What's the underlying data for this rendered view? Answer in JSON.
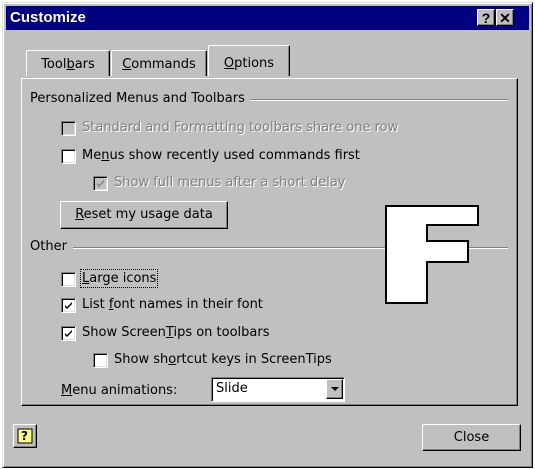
{
  "window": {
    "title": "Customize",
    "help_button": "?",
    "close_button": "✕"
  },
  "tabs": [
    {
      "pre": "Tool",
      "key": "b",
      "post": "ars"
    },
    {
      "pre": "",
      "key": "C",
      "post": "ommands"
    },
    {
      "pre": "",
      "key": "O",
      "post": "ptions"
    }
  ],
  "active_tab": "Options",
  "personalized": {
    "group_label": "Personalized Menus and Toolbars",
    "standard_row": {
      "text": "Standard and Formatting toolbars share one row",
      "checked": false,
      "enabled": false
    },
    "recent_first": {
      "pre": "Me",
      "key": "n",
      "post": "us show recently used commands first",
      "checked": false
    },
    "full_menus": {
      "text": "Show full menus after a short delay",
      "checked": true,
      "enabled": false
    },
    "reset_button": {
      "pre": "",
      "key": "R",
      "post": "eset my usage data"
    }
  },
  "other": {
    "group_label": "Other",
    "large_icons": {
      "pre": "",
      "key": "L",
      "post": "arge icons",
      "checked": false
    },
    "font_names": {
      "pre": "List ",
      "key": "f",
      "post": "ont names in their font",
      "checked": true
    },
    "screentips": {
      "pre": "Show Screen",
      "key": "T",
      "post": "ips on toolbars",
      "checked": true
    },
    "shortcut_keys": {
      "pre": "Show sh",
      "key": "o",
      "post": "rtcut keys in ScreenTips",
      "checked": false
    },
    "menu_animations": {
      "pre": "",
      "key": "M",
      "post": "enu animations:",
      "value": "Slide"
    }
  },
  "footer": {
    "help_icon": "?",
    "close_label": "Close"
  },
  "overlay_letter": "F"
}
